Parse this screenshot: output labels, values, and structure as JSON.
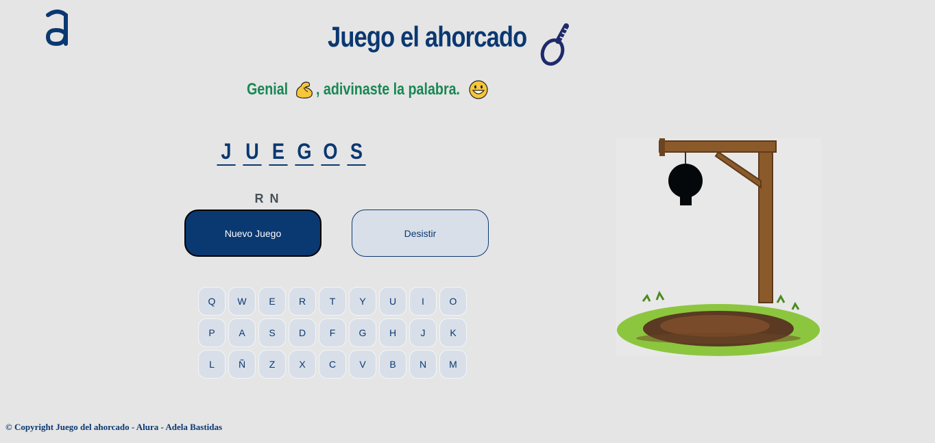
{
  "header": {
    "logo_icon": "alura-logo",
    "title": "Juego el ahorcado",
    "title_icon": "noose-icon"
  },
  "status": {
    "message_part1": "Genial",
    "message_part2": ", adivinaste la palabra.",
    "emoji1": "flexed-biceps-emoji",
    "emoji2": "grinning-face-emoji",
    "color": "#198754"
  },
  "word": {
    "letters": [
      "J",
      "U",
      "E",
      "G",
      "O",
      "S"
    ]
  },
  "wrong_letters": "R N",
  "buttons": {
    "new_game": "Nuevo Juego",
    "give_up": "Desistir"
  },
  "keyboard": {
    "rows": [
      [
        "Q",
        "W",
        "E",
        "R",
        "T",
        "Y",
        "U",
        "I",
        "O"
      ],
      [
        "P",
        "A",
        "S",
        "D",
        "F",
        "G",
        "H",
        "J",
        "K"
      ],
      [
        "L",
        "Ñ",
        "Z",
        "X",
        "C",
        "V",
        "B",
        "N",
        "M"
      ]
    ]
  },
  "footer": {
    "text": "© Copyright Juego del ahorcado - Alura - Adela Bastidas"
  },
  "colors": {
    "brand": "#0a3871",
    "background": "#e5e5e5",
    "key_bg": "#d8dfe8",
    "success": "#198754"
  }
}
